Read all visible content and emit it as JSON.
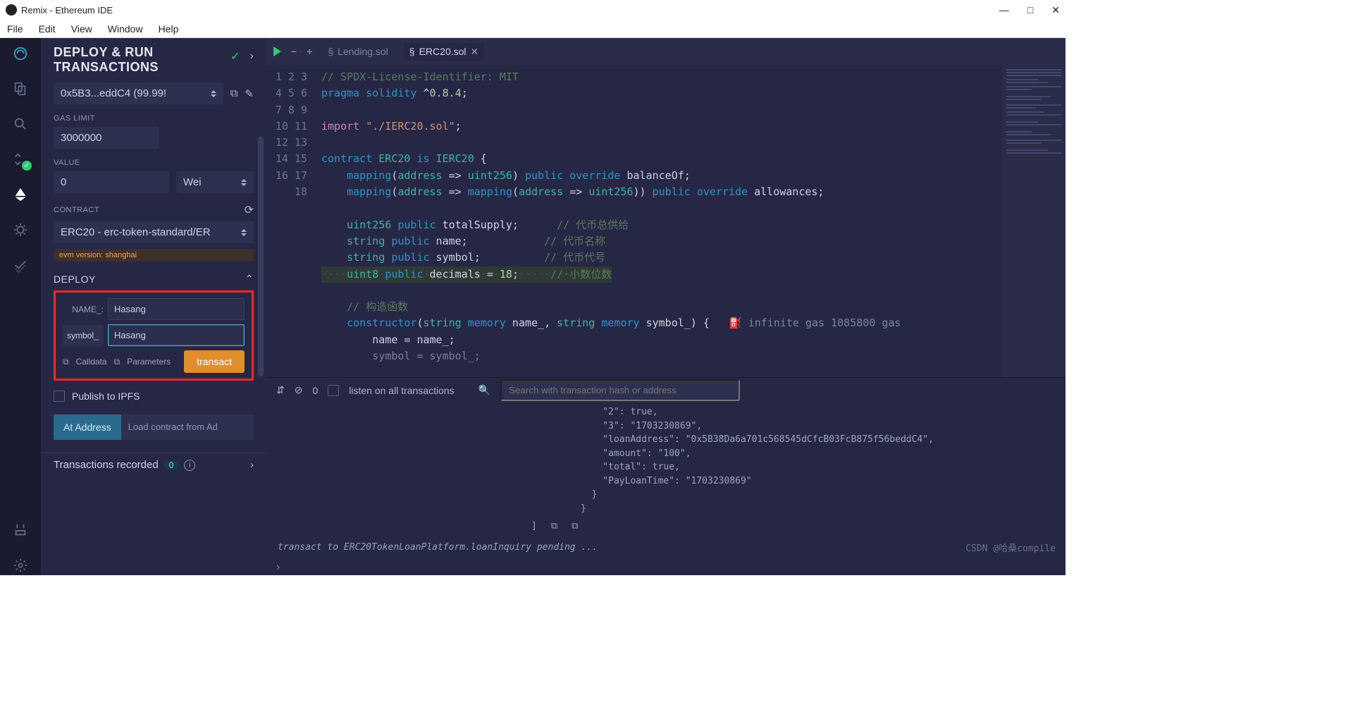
{
  "window": {
    "title": "Remix - Ethereum IDE"
  },
  "menubar": [
    "File",
    "Edit",
    "View",
    "Window",
    "Help"
  ],
  "rail": {
    "items": [
      {
        "name": "home-icon"
      },
      {
        "name": "files-icon"
      },
      {
        "name": "search-icon"
      },
      {
        "name": "compiler-icon",
        "badge": "ok"
      },
      {
        "name": "deploy-icon",
        "active": true
      },
      {
        "name": "debugger-icon"
      },
      {
        "name": "test-icon"
      }
    ],
    "bottom": [
      {
        "name": "plugin-icon"
      },
      {
        "name": "settings-icon"
      }
    ]
  },
  "panel": {
    "title_line1": "DEPLOY & RUN",
    "title_line2": "TRANSACTIONS",
    "account": {
      "label": "0x5B3...eddC4 (99.99!"
    },
    "gas": {
      "label": "GAS LIMIT",
      "value": "3000000"
    },
    "value": {
      "label": "VALUE",
      "amount": "0",
      "unit": "Wei"
    },
    "contract": {
      "label": "CONTRACT",
      "selected": "ERC20 - erc-token-standard/ER"
    },
    "evm_badge": "evm version: shanghai",
    "deploy": {
      "header": "DEPLOY",
      "params": [
        {
          "label": "NAME_:",
          "value": "Hasang"
        },
        {
          "label": "symbol_",
          "value": "Hasang",
          "boxed": true,
          "focused": true
        }
      ],
      "calldata": "Calldata",
      "parameters": "Parameters",
      "transact": "transact"
    },
    "publish_ipfs": "Publish to IPFS",
    "at_address": {
      "button": "At Address",
      "placeholder": "Load contract from Ad"
    },
    "tx_recorded": {
      "label": "Transactions recorded",
      "count": "0"
    }
  },
  "editor": {
    "tabs": [
      {
        "label": "Lending.sol",
        "active": false
      },
      {
        "label": "ERC20.sol",
        "active": true
      }
    ],
    "gas_hint": "infinite gas 1085800 gas",
    "lines": [
      {
        "n": 1,
        "cls": "comment",
        "text": "// SPDX-License-Identifier: MIT"
      },
      {
        "n": 2,
        "tokens": [
          [
            "kw",
            "pragma"
          ],
          [
            "",
            " "
          ],
          [
            "kw",
            "solidity"
          ],
          [
            "",
            " ^"
          ],
          [
            "num",
            "0.8.4"
          ],
          [
            "",
            ";"
          ]
        ]
      },
      {
        "n": 3,
        "text": ""
      },
      {
        "n": 4,
        "tokens": [
          [
            "kw2",
            "import"
          ],
          [
            "",
            " "
          ],
          [
            "str",
            "\"./IERC20.sol\""
          ],
          [
            "",
            ";"
          ]
        ]
      },
      {
        "n": 5,
        "text": ""
      },
      {
        "n": 6,
        "tokens": [
          [
            "kw",
            "contract"
          ],
          [
            "",
            " "
          ],
          [
            "type",
            "ERC20"
          ],
          [
            "",
            " "
          ],
          [
            "kw",
            "is"
          ],
          [
            "",
            " "
          ],
          [
            "type",
            "IERC20"
          ],
          [
            "",
            " {"
          ]
        ]
      },
      {
        "n": 7,
        "tokens": [
          [
            "",
            "    "
          ],
          [
            "kw",
            "mapping"
          ],
          [
            "",
            "("
          ],
          [
            "type",
            "address"
          ],
          [
            "",
            " => "
          ],
          [
            "type",
            "uint256"
          ],
          [
            "",
            ") "
          ],
          [
            "kw",
            "public"
          ],
          [
            "",
            " "
          ],
          [
            "kw",
            "override"
          ],
          [
            "",
            " balanceOf;"
          ]
        ]
      },
      {
        "n": 8,
        "tokens": [
          [
            "",
            "    "
          ],
          [
            "kw",
            "mapping"
          ],
          [
            "",
            "("
          ],
          [
            "type",
            "address"
          ],
          [
            "",
            " => "
          ],
          [
            "kw",
            "mapping"
          ],
          [
            "",
            "("
          ],
          [
            "type",
            "address"
          ],
          [
            "",
            " => "
          ],
          [
            "type",
            "uint256"
          ],
          [
            "",
            ")) "
          ],
          [
            "kw",
            "public"
          ],
          [
            "",
            " "
          ],
          [
            "kw",
            "override"
          ],
          [
            "",
            " allowances;"
          ]
        ]
      },
      {
        "n": 9,
        "text": ""
      },
      {
        "n": 10,
        "tokens": [
          [
            "",
            "    "
          ],
          [
            "type",
            "uint256"
          ],
          [
            "",
            " "
          ],
          [
            "kw",
            "public"
          ],
          [
            "",
            " totalSupply;      "
          ],
          [
            "comment",
            "// 代币总供给"
          ]
        ]
      },
      {
        "n": 11,
        "tokens": [
          [
            "",
            "    "
          ],
          [
            "type",
            "string"
          ],
          [
            "",
            " "
          ],
          [
            "kw",
            "public"
          ],
          [
            "",
            " name;            "
          ],
          [
            "comment",
            "// 代币名称"
          ]
        ]
      },
      {
        "n": 12,
        "tokens": [
          [
            "",
            "    "
          ],
          [
            "type",
            "string"
          ],
          [
            "",
            " "
          ],
          [
            "kw",
            "public"
          ],
          [
            "",
            " symbol;          "
          ],
          [
            "comment",
            "// 代币代号"
          ]
        ]
      },
      {
        "n": 13,
        "hl": true,
        "tokens": [
          [
            "dots",
            "····"
          ],
          [
            "type",
            "uint8"
          ],
          [
            "dots",
            "·"
          ],
          [
            "kw",
            "public"
          ],
          [
            "dots",
            "·"
          ],
          [
            "",
            "decimals"
          ],
          [
            "dots",
            "·"
          ],
          [
            "",
            "="
          ],
          [
            "dots",
            "·"
          ],
          [
            "num",
            "18"
          ],
          [
            "",
            ";"
          ],
          [
            "dots",
            "·····"
          ],
          [
            "comment",
            "//·小数位数"
          ]
        ]
      },
      {
        "n": 14,
        "text": ""
      },
      {
        "n": 15,
        "tokens": [
          [
            "",
            "    "
          ],
          [
            "comment",
            "// 构造函数"
          ]
        ]
      },
      {
        "n": 16,
        "gas": true,
        "tokens": [
          [
            "",
            "    "
          ],
          [
            "kw",
            "constructor"
          ],
          [
            "",
            "("
          ],
          [
            "type",
            "string"
          ],
          [
            "",
            " "
          ],
          [
            "kw",
            "memory"
          ],
          [
            "",
            " name_, "
          ],
          [
            "type",
            "string"
          ],
          [
            "",
            " "
          ],
          [
            "kw",
            "memory"
          ],
          [
            "",
            " symbol_) {"
          ]
        ]
      },
      {
        "n": 17,
        "tokens": [
          [
            "",
            "        name = name_;"
          ]
        ]
      },
      {
        "n": 18,
        "tokens": [
          [
            "",
            "        symbol = symbol_;"
          ]
        ],
        "fade": true
      }
    ]
  },
  "terminal": {
    "listen": "listen on all transactions",
    "search_placeholder": "Search with transaction hash or address",
    "zero": "0",
    "json_lines": [
      "\"2\": true,",
      "\"3\": \"1703230869\",",
      "\"loanAddress\": \"0x5B38Da6a701c568545dCfcB03FcB875f56beddC4\",",
      "\"amount\": \"100\",",
      "\"total\": true,",
      "\"PayLoanTime\": \"1703230869\""
    ],
    "pending": "transact to ERC20TokenLoanPlatform.loanInquiry pending ...",
    "watermark": "CSDN @哈桑compile"
  }
}
